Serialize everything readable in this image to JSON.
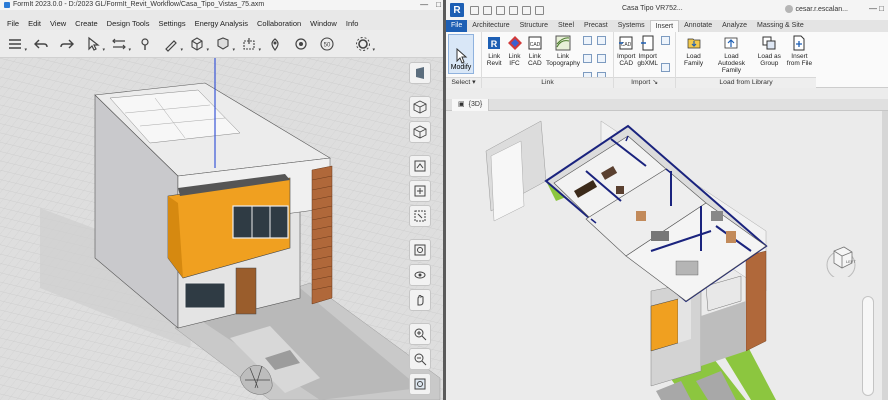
{
  "formit": {
    "title": "FormIt 2023.0.0 - D:/2023 GL/FormIt_Revit_Workflow/Casa_Tipo_Vistas_75.axm",
    "menu": [
      "File",
      "Edit",
      "View",
      "Create",
      "Design Tools",
      "Settings",
      "Energy Analysis",
      "Collaboration",
      "Window",
      "Info"
    ],
    "toolbar_icons": [
      "layers-icon",
      "undo-icon",
      "redo-icon",
      "select-icon",
      "move-icon",
      "paint-icon",
      "draw-icon",
      "shape-icon",
      "group-icon",
      "extrude-icon",
      "location-icon",
      "offset-icon",
      "scale-icon",
      "settings-icon"
    ],
    "sidebar_icons": [
      "perspective-icon",
      "cube-top-icon",
      "cube-front-icon",
      "view-3d-icon",
      "view-home-icon",
      "zoom-window-icon",
      "view-rotate-icon",
      "view-orbit-icon",
      "pan-icon",
      "zoom-in-icon",
      "zoom-out-icon",
      "zoom-extents-icon"
    ]
  },
  "revit": {
    "logo": "R",
    "document_title": "Casa Tipo VR752...",
    "user": "cesar.r.escalan...",
    "tabs": [
      "File",
      "Architecture",
      "Structure",
      "Steel",
      "Precast",
      "Systems",
      "Insert",
      "Annotate",
      "Analyze",
      "Massing & Site"
    ],
    "active_tab": "Insert",
    "ribbon": {
      "select": {
        "modify_label": "Modify",
        "group_label": "Select"
      },
      "link": {
        "buttons": [
          {
            "label": "Link Revit",
            "icon": "link-revit-icon"
          },
          {
            "label": "Link IFC",
            "icon": "link-ifc-icon"
          },
          {
            "label": "Link CAD",
            "icon": "link-cad-icon"
          },
          {
            "label": "Link Topography",
            "icon": "link-topography-icon"
          }
        ],
        "group_label": "Link"
      },
      "import": {
        "buttons": [
          {
            "label": "Import CAD",
            "icon": "import-cad-icon"
          },
          {
            "label": "Import gbXML",
            "icon": "import-gbxml-icon"
          }
        ],
        "group_label": "Import"
      },
      "library": {
        "buttons": [
          {
            "label": "Load Family",
            "icon": "load-family-icon"
          },
          {
            "label": "Load Autodesk Family",
            "icon": "load-autodesk-family-icon"
          },
          {
            "label": "Load as Group",
            "icon": "load-as-group-icon"
          },
          {
            "label": "Insert from File",
            "icon": "insert-from-file-icon"
          }
        ],
        "group_label": "Load from Library"
      }
    },
    "view_tab": "{3D}",
    "view_cube_label": "LEFT"
  },
  "colors": {
    "revit_blue": "#1d5fb4",
    "orange": "#f0a020",
    "grass": "#8cc63f",
    "wall_outline": "#1a237e"
  }
}
